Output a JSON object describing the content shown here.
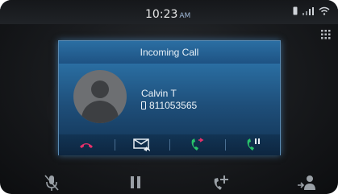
{
  "status_bar": {
    "time": "10:23",
    "ampm": "AM",
    "icons": [
      "phone-icon",
      "signal-bars-icon",
      "wifi-icon"
    ]
  },
  "dialog": {
    "title": "Incoming Call",
    "caller": {
      "name": "Calvin T",
      "number": "811053565"
    },
    "actions": [
      {
        "name": "decline-call-button",
        "icon": "hang-up-icon",
        "color": "#e8306a"
      },
      {
        "name": "reply-message-button",
        "icon": "message-reply-icon",
        "color": "#e8eef4"
      },
      {
        "name": "answer-end-active-button",
        "icon": "answer-swap-icon",
        "color": "#29c46a"
      },
      {
        "name": "answer-hold-button",
        "icon": "answer-hold-icon",
        "color": "#29c46a"
      }
    ]
  },
  "bottom_bar": {
    "items": [
      "mute-mic-icon",
      "pause-icon",
      "add-call-icon",
      "transfer-to-phone-icon"
    ]
  },
  "colors": {
    "accent_blue": "#2b6fa3",
    "decline_red": "#e8306a",
    "answer_green": "#29c46a"
  }
}
